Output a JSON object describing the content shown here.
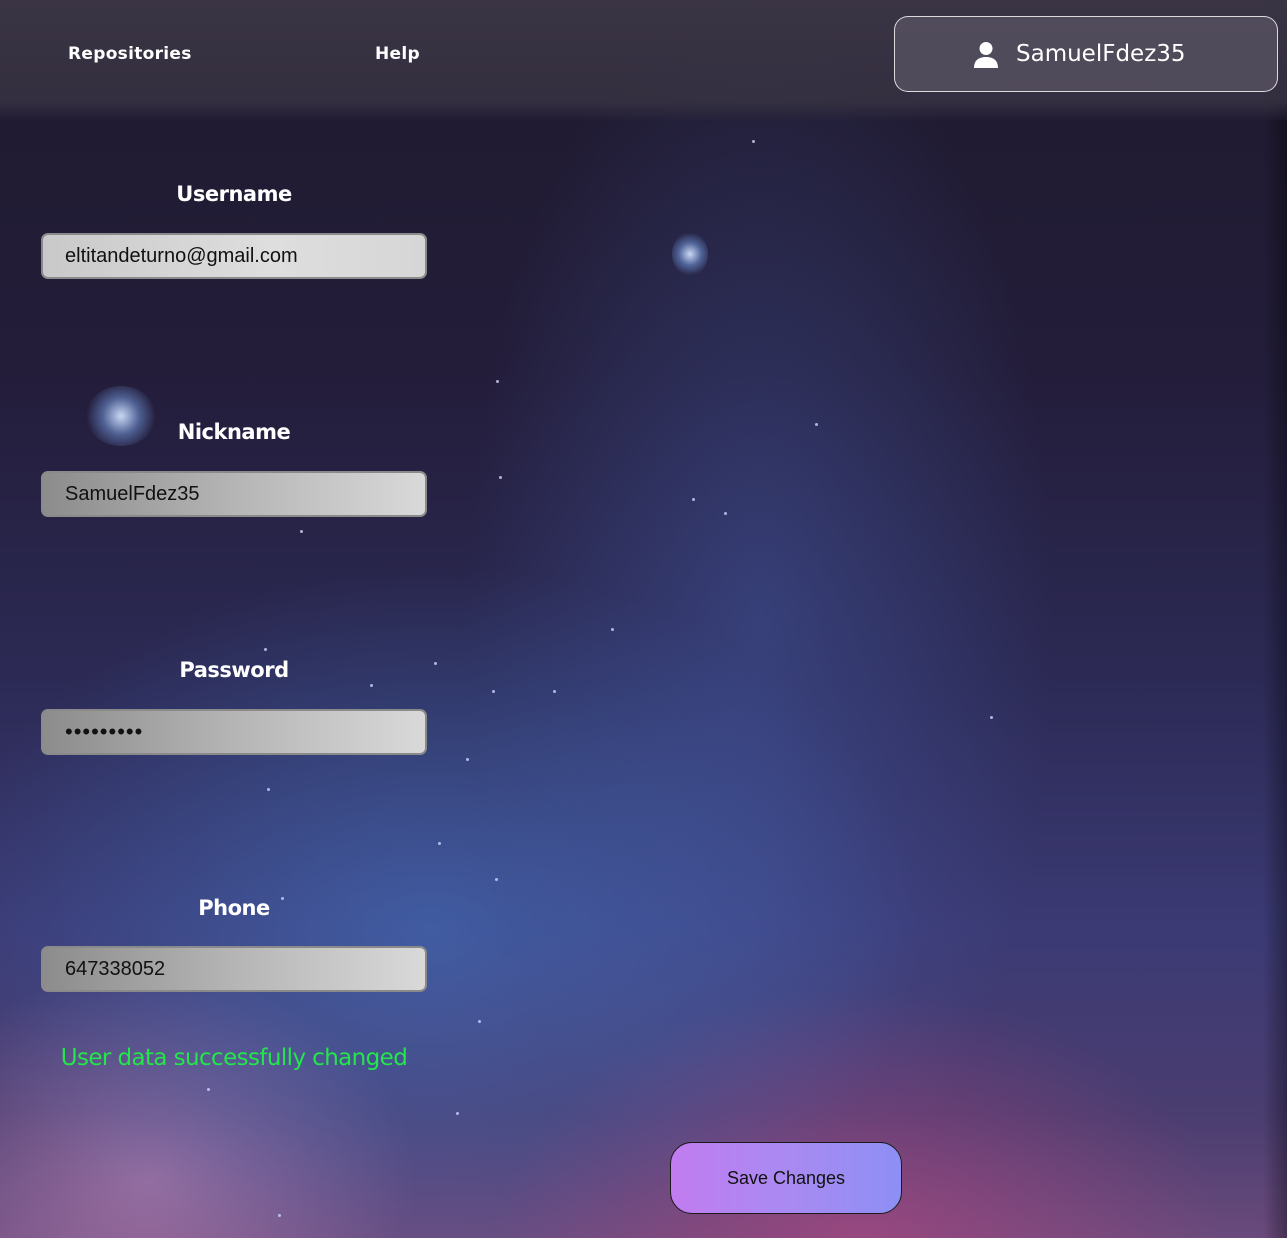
{
  "header": {
    "nav": [
      {
        "label": "Repositories"
      },
      {
        "label": "Help"
      }
    ],
    "user": {
      "name": "SamuelFdez35",
      "icon": "user-icon"
    }
  },
  "form": {
    "username": {
      "label": "Username",
      "value": "eltitandeturno@gmail.com"
    },
    "nickname": {
      "label": "Nickname",
      "value": "SamuelFdez35"
    },
    "password": {
      "label": "Password",
      "value": "•••••••••"
    },
    "phone": {
      "label": "Phone",
      "value": "647338052"
    },
    "success_message": "User data successfully changed",
    "save_label": "Save Changes"
  },
  "colors": {
    "success": "#22e64a",
    "save_gradient_start": "#c17cf0",
    "save_gradient_end": "#8d8ff4"
  }
}
